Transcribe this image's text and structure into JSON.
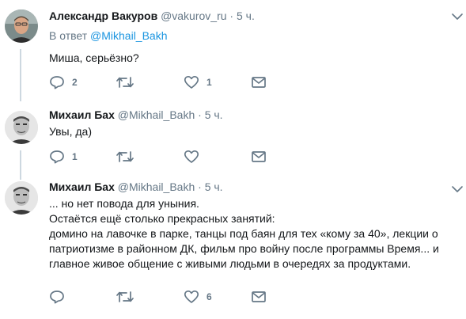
{
  "tweets": [
    {
      "name": "Александр Вакуров",
      "handle": "@vakurov_ru",
      "dot": "·",
      "time": "5 ч.",
      "reply_prefix": "В ответ",
      "reply_mention": "@Mikhail_Bakh",
      "lines": [
        "Миша, серьёзно?"
      ],
      "replies": "2",
      "retweets": "",
      "likes": "1"
    },
    {
      "name": "Михаил Бах",
      "handle": "@Mikhail_Bakh",
      "dot": "·",
      "time": "5 ч.",
      "lines": [
        "Увы, да)"
      ],
      "replies": "1",
      "retweets": "",
      "likes": ""
    },
    {
      "name": "Михаил Бах",
      "handle": "@Mikhail_Bakh",
      "dot": "·",
      "time": "5 ч.",
      "lines": [
        "... но нет повода для уныния.",
        "Остаётся ещё столько прекрасных занятий:",
        "домино на лавочке в парке, танцы под баян для тех «кому за 40», лекции о",
        "патриотизме в районном ДК, фильм про войну после программы Время... и",
        "главное живое общение с живыми людьми в очередях за продуктами."
      ],
      "replies": "",
      "retweets": "",
      "likes": "6"
    }
  ],
  "icons": {
    "reply": "reply-icon",
    "retweet": "retweet-icon",
    "like": "heart-icon",
    "message": "envelope-icon",
    "more": "chevron-down-icon"
  },
  "colors": {
    "name": "#14171a",
    "muted": "#657786",
    "link": "#1b95e0",
    "thread_line": "#cdd8e0"
  }
}
